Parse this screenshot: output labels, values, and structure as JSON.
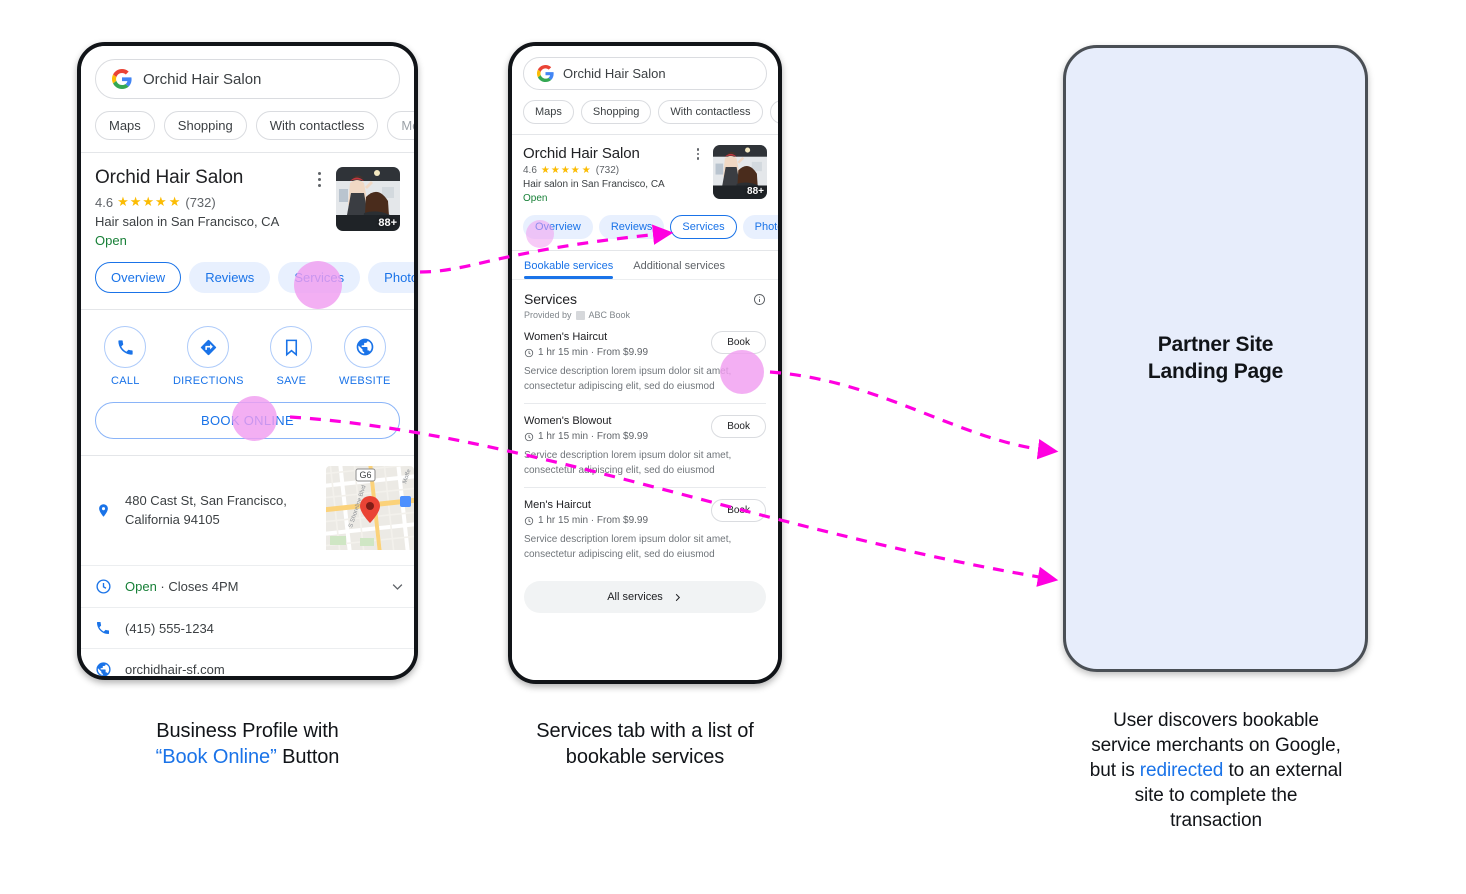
{
  "phone1": {
    "search": {
      "query": "Orchid Hair Salon",
      "icon": "google-logo-icon"
    },
    "filter_chips": [
      "Maps",
      "Shopping",
      "With contactless",
      "Me"
    ],
    "business": {
      "name": "Orchid Hair Salon",
      "rating": "4.6",
      "stars": "★★★★",
      "star_off": "★",
      "review_count": "(732)",
      "category": "Hair salon in San Francisco, CA",
      "status": "Open",
      "photo_badge": "88+"
    },
    "tabs": [
      "Overview",
      "Reviews",
      "Services",
      "Photo"
    ],
    "actions": [
      {
        "label": "CALL",
        "icon": "phone-icon"
      },
      {
        "label": "DIRECTIONS",
        "icon": "directions-icon"
      },
      {
        "label": "SAVE",
        "icon": "bookmark-icon"
      },
      {
        "label": "WEBSITE",
        "icon": "globe-icon"
      }
    ],
    "book_online": "BOOK ONLINE",
    "address": "480 Cast St, San Francisco, California 94105",
    "map_labels": {
      "route": "G6",
      "street1": "S Shoreline Blvd",
      "street2": "Moffe"
    },
    "hours_open": "Open",
    "hours_rest": " · Closes 4PM",
    "phone_number": "(415) 555-1234",
    "website": "orchidhair-sf.com"
  },
  "phone2": {
    "search": {
      "query": "Orchid Hair Salon",
      "icon": "google-logo-icon"
    },
    "filter_chips": [
      "Maps",
      "Shopping",
      "With contactless",
      "M"
    ],
    "business": {
      "name": "Orchid Hair Salon",
      "rating": "4.6",
      "stars": "★★★★",
      "star_off": "★",
      "review_count": "(732)",
      "category": "Hair salon in San Francisco, CA",
      "status": "Open",
      "photo_badge": "88+"
    },
    "tabs": [
      "Overview",
      "Reviews",
      "Services",
      "Photo"
    ],
    "active_tab": "Services",
    "subtabs": [
      "Bookable services",
      "Additional services"
    ],
    "active_subtab": "Bookable services",
    "services_title": "Services",
    "provided_by": "Provided by",
    "provider_name": "ABC Book",
    "services": [
      {
        "name": "Women's Haircut",
        "meta": "1 hr 15 min · From $9.99",
        "description": "Service description lorem ipsum dolor sit amet, consectetur adipiscing elit, sed do eiusmod",
        "button": "Book"
      },
      {
        "name": "Women's Blowout",
        "meta": "1 hr 15 min · From $9.99",
        "description": "Service description lorem ipsum dolor sit amet, consectetur adipiscing elit, sed do eiusmod",
        "button": "Book"
      },
      {
        "name": "Men's Haircut",
        "meta": "1 hr 15 min · From $9.99",
        "description": "Service description lorem ipsum dolor sit amet, consectetur adipiscing elit, sed do eiusmod",
        "button": "Book"
      }
    ],
    "all_services": "All services"
  },
  "phone3": {
    "title_line1": "Partner Site",
    "title_line2": "Landing Page",
    "background_color": "#e7edfb"
  },
  "captions": {
    "caption1": {
      "line1": "Business Profile with",
      "highlight": "“Book Online”",
      "line2_rest": " Button"
    },
    "caption2": {
      "line1": "Services tab with a list of",
      "line2": "bookable services"
    },
    "caption3": {
      "line1": "User discovers bookable",
      "line2": "service merchants on Google,",
      "line3_pre": "but is ",
      "line3_highlight": "redirected",
      "line3_post": " to an external",
      "line4": "site to complete the",
      "line5": "transaction"
    }
  },
  "colors": {
    "accent_blue": "#1a73e8",
    "arrow_magenta": "#ff00e0",
    "highlight_pink": "#f09ef0",
    "open_green": "#188038",
    "star_gold": "#fbbc04",
    "partner_bg": "#e7edfb"
  }
}
